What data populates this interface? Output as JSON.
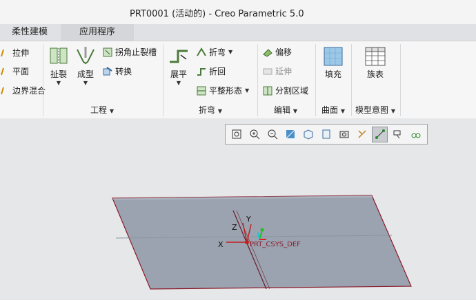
{
  "window": {
    "title": "PRT0001 (活动的) - Creo Parametric 5.0"
  },
  "tabs": [
    "柔性建模",
    "应用程序"
  ],
  "ribbon": {
    "left_items": [
      "拉伸",
      "平面",
      "边界混合"
    ],
    "engineering": {
      "label": "工程",
      "rip": "扯裂",
      "form": "成型",
      "corner_relief": "拐角止裂槽",
      "convert": "转换"
    },
    "bend": {
      "label": "折弯",
      "unbend": "展平",
      "bend": "折弯",
      "bend_back": "折回",
      "flat_state": "平整形态"
    },
    "editing": {
      "label": "编辑",
      "offset": "偏移",
      "extend": "延伸",
      "split_area": "分割区域"
    },
    "surfaces": {
      "label": "曲面",
      "fill": "填充"
    },
    "model_intent": {
      "label": "模型意图",
      "family_table": "族表"
    }
  },
  "view_toolbar": {
    "icons": [
      "refit-icon",
      "zoom-in-icon",
      "zoom-out-icon",
      "repaint-icon",
      "display-style-icon",
      "saved-orientations-icon",
      "view-manager-icon",
      "datum-display-icon",
      "spin-center-icon",
      "annotation-display-icon",
      "perspective-icon"
    ],
    "active": "spin-center-icon"
  },
  "model": {
    "csys_label": "PRT_CSYS_DEF",
    "axis_x": "X",
    "axis_y": "Y",
    "axis_z": "Z",
    "plate_color": "#9aa3af"
  }
}
